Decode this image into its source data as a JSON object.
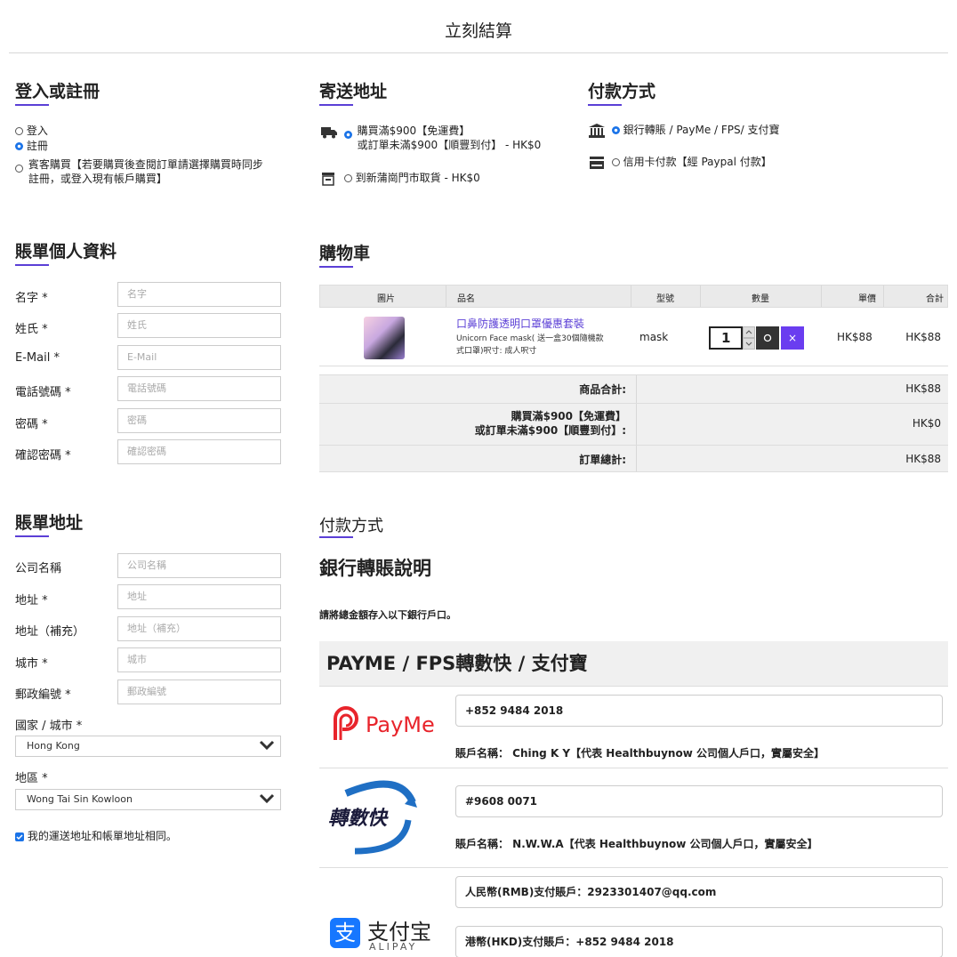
{
  "header": {
    "title": "立刻結算"
  },
  "login": {
    "title": "登入或註冊",
    "options": [
      "登入",
      "註冊",
      "賓客購買【若要購買後查閱訂單請選擇購買時同步",
      "註冊，或登入現有帳戶購買】"
    ]
  },
  "shipping": {
    "title": "寄送地址",
    "opt1_line1": "購買滿$900【免運費】",
    "opt1_line2": "或訂單未滿$900【順豐到付】 - HK$0",
    "opt2": "到新蒲崗門市取貨 - HK$0"
  },
  "payment_top": {
    "title": "付款方式",
    "opt1": "銀行轉賬 / PayMe / FPS/ 支付寶",
    "opt2": "信用卡付款【經 Paypal 付款】"
  },
  "billing": {
    "title": "賬單個人資料",
    "fields": [
      {
        "label": "名字 *",
        "placeholder": "名字"
      },
      {
        "label": "姓氏 *",
        "placeholder": "姓氏"
      },
      {
        "label": "E-Mail *",
        "placeholder": "E-Mail"
      },
      {
        "label": "電話號碼 *",
        "placeholder": "電話號碼"
      },
      {
        "label": "密碼 *",
        "placeholder": "密碼"
      },
      {
        "label": "確認密碼 *",
        "placeholder": "確認密碼"
      }
    ]
  },
  "address": {
    "title": "賬單地址",
    "fields": [
      {
        "label": "公司名稱",
        "placeholder": "公司名稱"
      },
      {
        "label": "地址 *",
        "placeholder": "地址"
      },
      {
        "label": "地址（補充）",
        "placeholder": "地址（補充）"
      },
      {
        "label": "城市 *",
        "placeholder": "城市"
      },
      {
        "label": "郵政編號 *",
        "placeholder": "郵政編號"
      }
    ],
    "country_label": "國家 / 城市 *",
    "country_value": "Hong Kong",
    "region_label": "地區 *",
    "region_value": "Wong Tai Sin Kowloon",
    "same_address": "我的運送地址和帳單地址相同。"
  },
  "cart": {
    "title": "購物車",
    "headers": [
      "圖片",
      "品名",
      "型號",
      "數量",
      "單價",
      "合計"
    ],
    "item": {
      "name": "口鼻防護透明口罩優惠套裝",
      "desc1": "Unicorn Face mask( 送一盒30個隨機款",
      "desc2": "式口罩)呎寸: 成人呎寸",
      "model": "mask",
      "qty": "1",
      "price": "HK$88",
      "total": "HK$88",
      "remove": "×"
    },
    "summary": [
      {
        "label1": "商品合計:",
        "label2": "",
        "value": "HK$88"
      },
      {
        "label1": "購買滿$900【免運費】",
        "label2": "或訂單未滿$900【順豐到付】:",
        "value": "HK$0"
      },
      {
        "label1": "訂單總計:",
        "label2": "",
        "value": "HK$88"
      }
    ]
  },
  "payment": {
    "title": "付款方式",
    "bank_title": "銀行轉賬說明",
    "bank_note": "請將總金額存入以下銀行戶口。",
    "banner": "PAYME / FPS轉數快 / 支付寶",
    "payme": {
      "logo": "PayMe",
      "number": "+852 9484 2018",
      "account": "賬戶名稱： Ching K Y【代表 Healthbuynow 公司個人戶口，實屬安全】"
    },
    "fps": {
      "logo": "轉數快",
      "number": "#9608 0071",
      "account": "賬戶名稱： N.W.W.A【代表 Healthbuynow 公司個人戶口，實屬安全】"
    },
    "alipay": {
      "logo_cn": "支付宝",
      "logo_en": "ALIPAY",
      "rmb": "人民幣(RMB)支付賬戶：2923301407@qq.com",
      "hkd": "港幣(HKD)支付賬戶：+852 9484 2018"
    }
  }
}
